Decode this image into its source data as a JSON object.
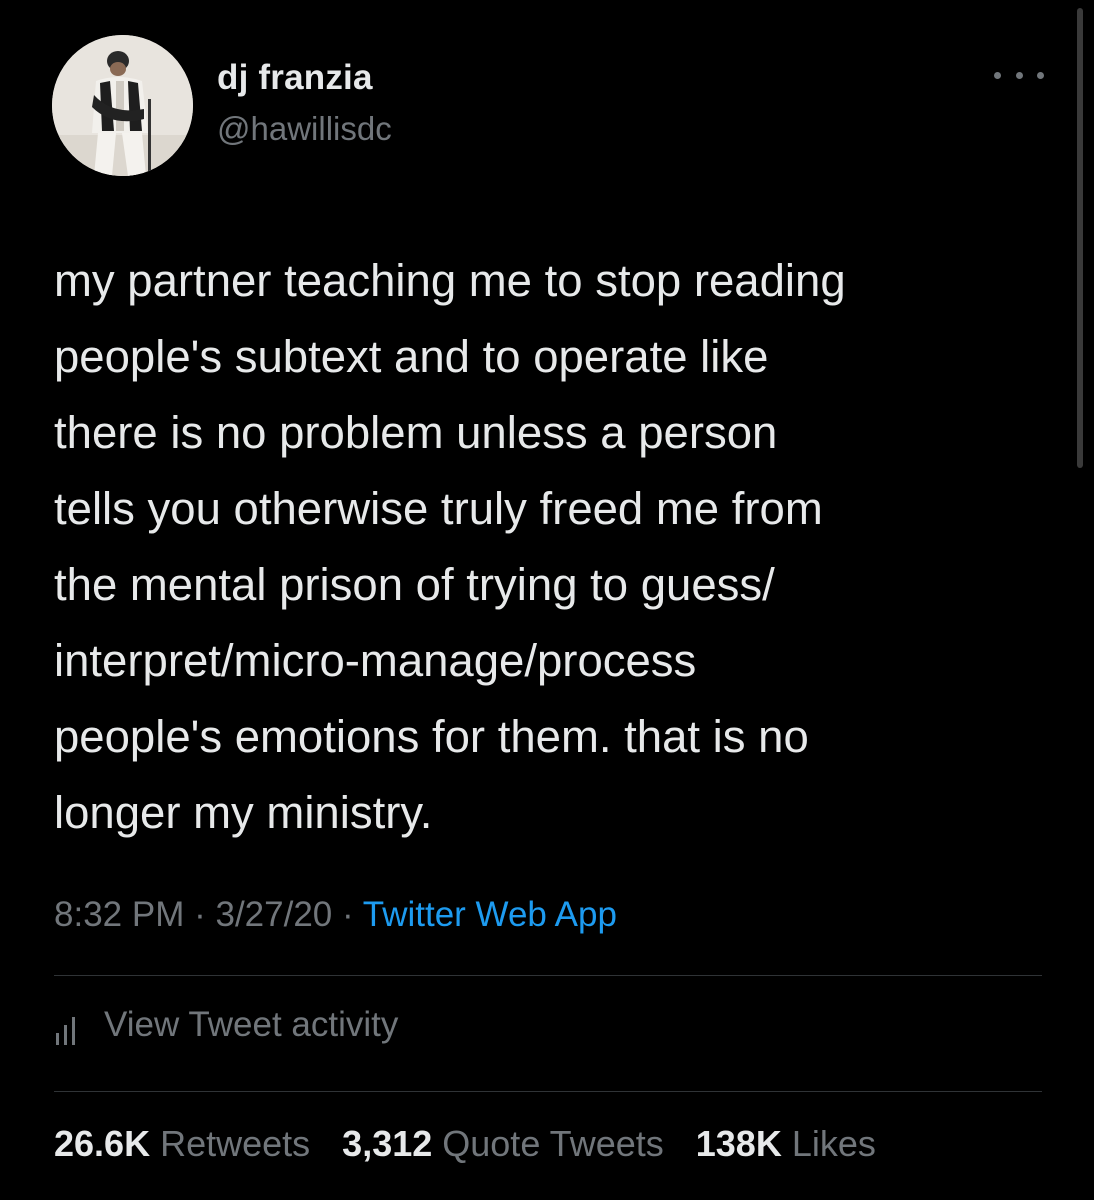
{
  "author": {
    "display_name": "dj franzia",
    "handle": "@hawillisdc",
    "avatar_icon": "profile-photo"
  },
  "more_icon": "ellipsis-horizontal-icon",
  "tweet": {
    "text": "my partner teaching me to stop reading\npeople's subtext and to operate like\nthere is no problem unless a person\ntells you otherwise truly freed me from\nthe mental prison of trying to guess/\ninterpret/micro-manage/process\npeople's emotions for them. that is no\nlonger my ministry."
  },
  "meta": {
    "time": "8:32 PM",
    "separator": "·",
    "date": "3/27/20",
    "source": "Twitter Web App"
  },
  "activity": {
    "icon": "bar-chart-icon",
    "label": "View Tweet activity"
  },
  "stats": {
    "retweets_count": "26.6K",
    "retweets_label": "Retweets",
    "quotes_count": "3,312",
    "quotes_label": "Quote Tweets",
    "likes_count": "138K",
    "likes_label": "Likes"
  },
  "colors": {
    "background": "#000000",
    "primary_text": "#e7e9ea",
    "secondary_text": "#71767b",
    "link": "#1d9bf0",
    "divider": "#2f3336"
  }
}
